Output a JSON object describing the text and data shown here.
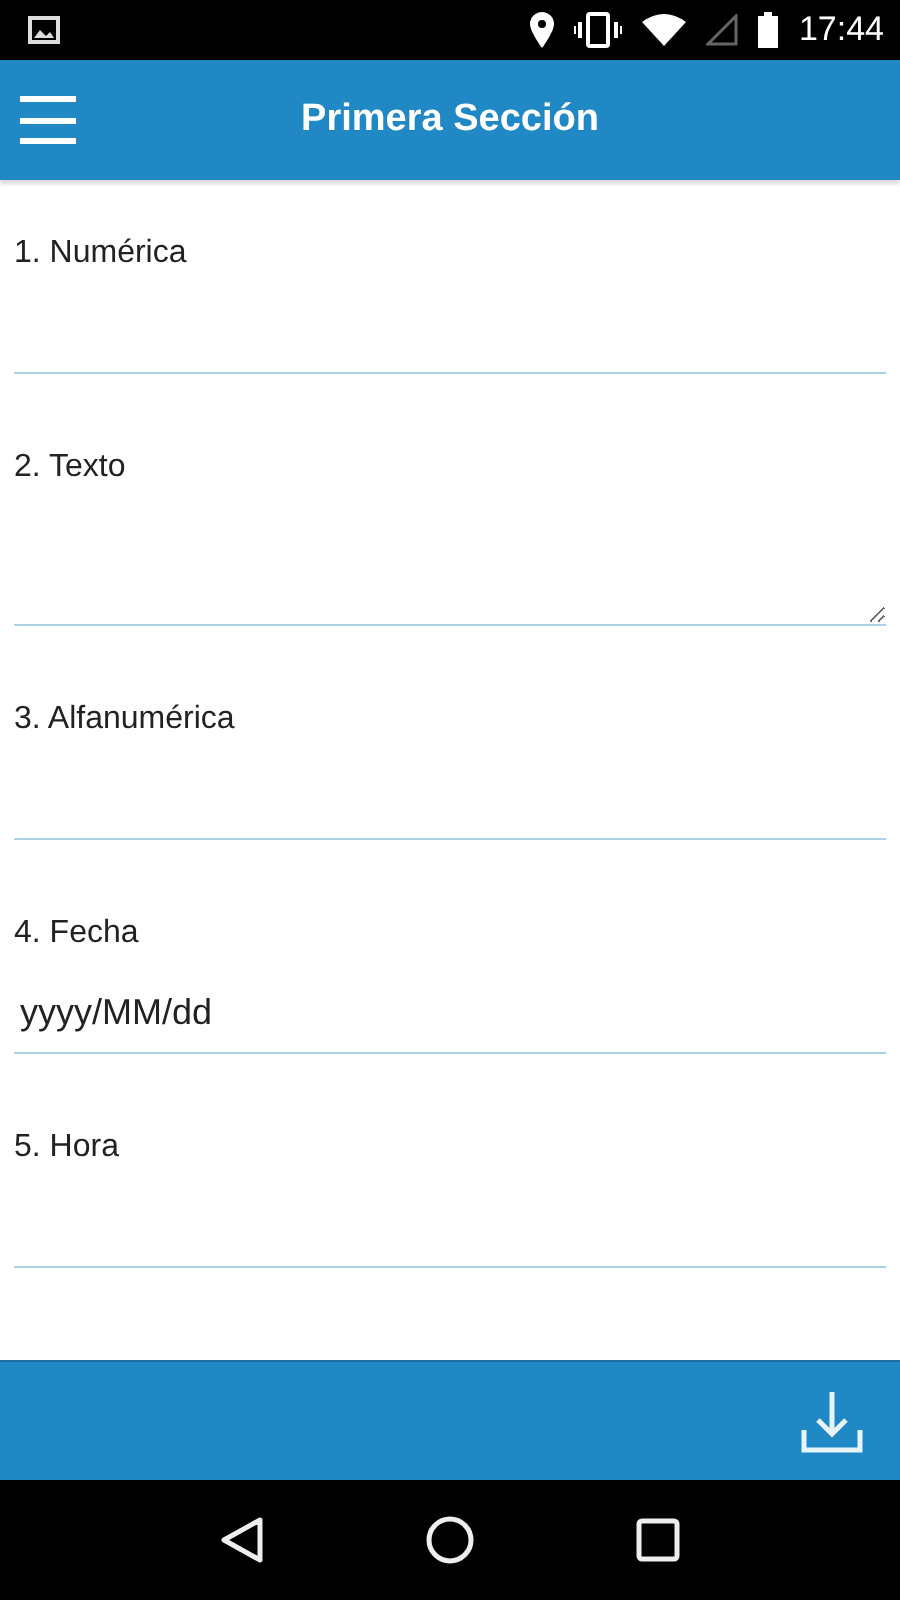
{
  "status_bar": {
    "time": "17:44"
  },
  "app_bar": {
    "title": "Primera Sección"
  },
  "fields": [
    {
      "label": "1. Numérica",
      "kind": "input"
    },
    {
      "label": "2. Texto",
      "kind": "textarea"
    },
    {
      "label": "3. Alfanumérica",
      "kind": "input"
    },
    {
      "label": "4. Fecha",
      "kind": "input",
      "value": "yyyy/MM/dd"
    },
    {
      "label": "5. Hora",
      "kind": "input"
    }
  ]
}
